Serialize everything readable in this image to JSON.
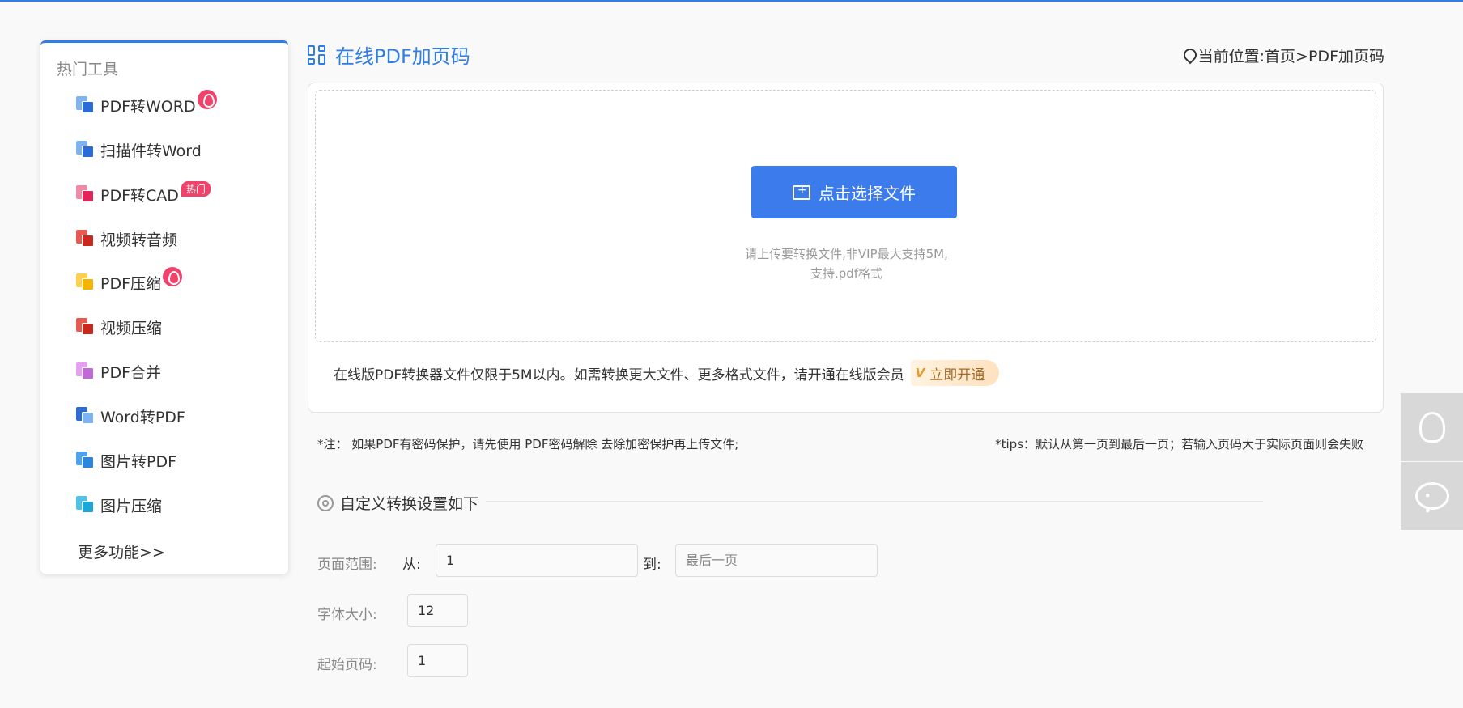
{
  "sidebar": {
    "title": "热门工具",
    "items": [
      {
        "label": "PDF转WORD",
        "badge": "fire"
      },
      {
        "label": "扫描件转Word"
      },
      {
        "label": "PDF转CAD",
        "badge_text": "热门"
      },
      {
        "label": "视频转音频"
      },
      {
        "label": "PDF压缩",
        "badge": "fire"
      },
      {
        "label": "视频压缩"
      },
      {
        "label": "PDF合并"
      },
      {
        "label": "Word转PDF"
      },
      {
        "label": "图片转PDF"
      },
      {
        "label": "图片压缩"
      }
    ],
    "more": "更多功能>>"
  },
  "header": {
    "title": "在线PDF加页码",
    "breadcrumb": "当前位置:首页>PDF加页码"
  },
  "upload": {
    "button": "点击选择文件",
    "hint_line1": "请上传要转换文件,非VIP最大支持5M,",
    "hint_line2": "支持.pdf格式",
    "member_note": "在线版PDF转换器文件仅限于5M以内。如需转换更大文件、更多格式文件，请开通在线版会员",
    "vip_icon": "V",
    "vip_button": "立即开通"
  },
  "notes": {
    "left": "*注： 如果PDF有密码保护，请先使用 PDF密码解除 去除加密保护再上传文件;",
    "right": "*tips：默认从第一页到最后一页；若输入页码大于实际页面则会失败"
  },
  "settings": {
    "title": "自定义转换设置如下",
    "page_range_label": "页面范围:",
    "from_label": "从:",
    "from_value": "1",
    "to_label": "到:",
    "to_placeholder": "最后一页",
    "font_size_label": "字体大小:",
    "font_size_value": "12",
    "start_page_label": "起始页码:",
    "start_page_value": "1"
  },
  "colors": {
    "accent": "#2f7ee8",
    "button": "#3b7bec",
    "badge": "#f0426a"
  }
}
